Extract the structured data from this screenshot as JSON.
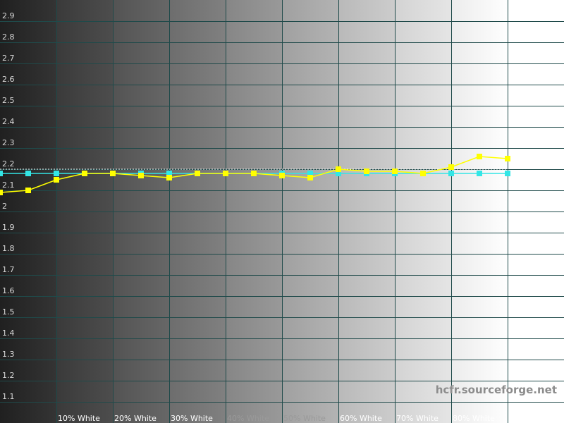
{
  "chart_data": {
    "type": "line",
    "title": "",
    "xlabel": "",
    "ylabel": "",
    "ylim": [
      1.0,
      3.0
    ],
    "yticks": [
      1.1,
      1.2,
      1.3,
      1.4,
      1.5,
      1.6,
      1.7,
      1.8,
      1.9,
      2,
      2.1,
      2.2,
      2.3,
      2.4,
      2.5,
      2.6,
      2.7,
      2.8,
      2.9
    ],
    "ytick_labels": [
      "1.1",
      "1.2",
      "1.3",
      "1.4",
      "1.5",
      "1.6",
      "1.7",
      "1.8",
      "1.9",
      "2",
      "2.1",
      "2.2",
      "2.3",
      "2.4",
      "2.5",
      "2.6",
      "2.7",
      "2.8",
      "2.9"
    ],
    "x": [
      0,
      5,
      10,
      15,
      20,
      25,
      30,
      35,
      40,
      45,
      50,
      55,
      60,
      65,
      70,
      75,
      80,
      85,
      90,
      95
    ],
    "xlim": [
      0,
      100
    ],
    "xticks": [
      10,
      20,
      30,
      40,
      50,
      60,
      70,
      80,
      90
    ],
    "xtick_labels": [
      "10% White",
      "20% White",
      "30% White",
      "40% White",
      "50% White",
      "60% White",
      "70% White",
      "80% White",
      "90% White"
    ],
    "grid": true,
    "background": "grayscale gradient black to white",
    "series": [
      {
        "color": "#ffff00",
        "marker": "square",
        "style": "solid",
        "values": [
          2.09,
          2.1,
          2.15,
          2.18,
          2.18,
          2.17,
          2.16,
          2.18,
          2.18,
          2.18,
          2.17,
          2.16,
          2.2,
          2.19,
          2.19,
          2.18,
          2.21,
          2.26,
          2.25
        ]
      },
      {
        "color": "#33e6e6",
        "marker": "square",
        "style": "solid",
        "values": [
          2.18,
          2.18,
          2.18,
          2.18,
          2.18,
          2.18,
          2.18,
          2.18,
          2.18,
          2.18,
          2.18,
          2.18,
          2.18,
          2.18,
          2.18,
          2.18,
          2.18,
          2.18,
          2.18
        ]
      },
      {
        "color": "#ffffff",
        "marker": "none",
        "style": "dotted",
        "values": [
          2.2,
          2.2,
          2.2,
          2.2,
          2.2,
          2.2,
          2.2,
          2.2,
          2.2,
          2.2,
          2.2,
          2.2,
          2.2,
          2.2,
          2.2,
          2.2,
          2.2,
          2.2,
          2.2
        ]
      }
    ]
  },
  "watermark": "hcfr.sourceforge.net"
}
